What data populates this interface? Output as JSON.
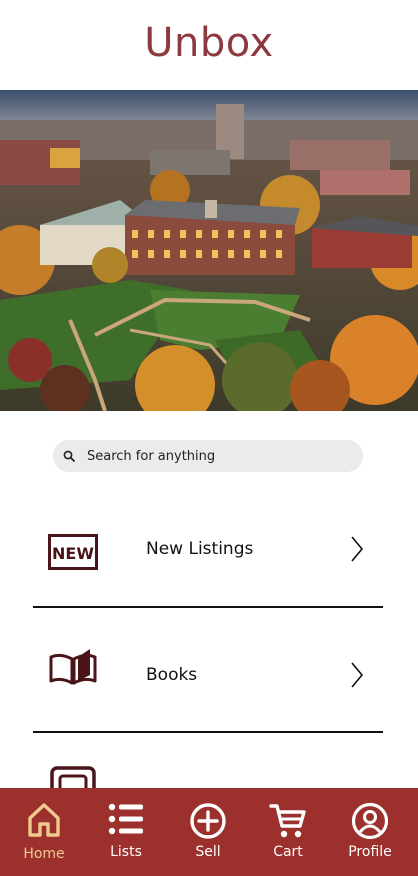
{
  "header": {
    "title": "Unbox"
  },
  "search": {
    "placeholder": "Search for anything"
  },
  "categories": [
    {
      "label": "New Listings",
      "icon": "new-badge-icon"
    },
    {
      "label": "Books",
      "icon": "open-book-icon"
    },
    {
      "label": "",
      "icon": "category-icon"
    }
  ],
  "tabs": [
    {
      "label": "Home",
      "icon": "home-icon",
      "active": true
    },
    {
      "label": "Lists",
      "icon": "list-icon",
      "active": false
    },
    {
      "label": "Sell",
      "icon": "plus-circle-icon",
      "active": false
    },
    {
      "label": "Cart",
      "icon": "cart-icon",
      "active": false
    },
    {
      "label": "Profile",
      "icon": "profile-icon",
      "active": false
    }
  ],
  "colors": {
    "title": "#8c3a3f",
    "tabbar": "#9b302d",
    "active_tab": "#f0c98e",
    "icon_dark": "#4a1418"
  }
}
